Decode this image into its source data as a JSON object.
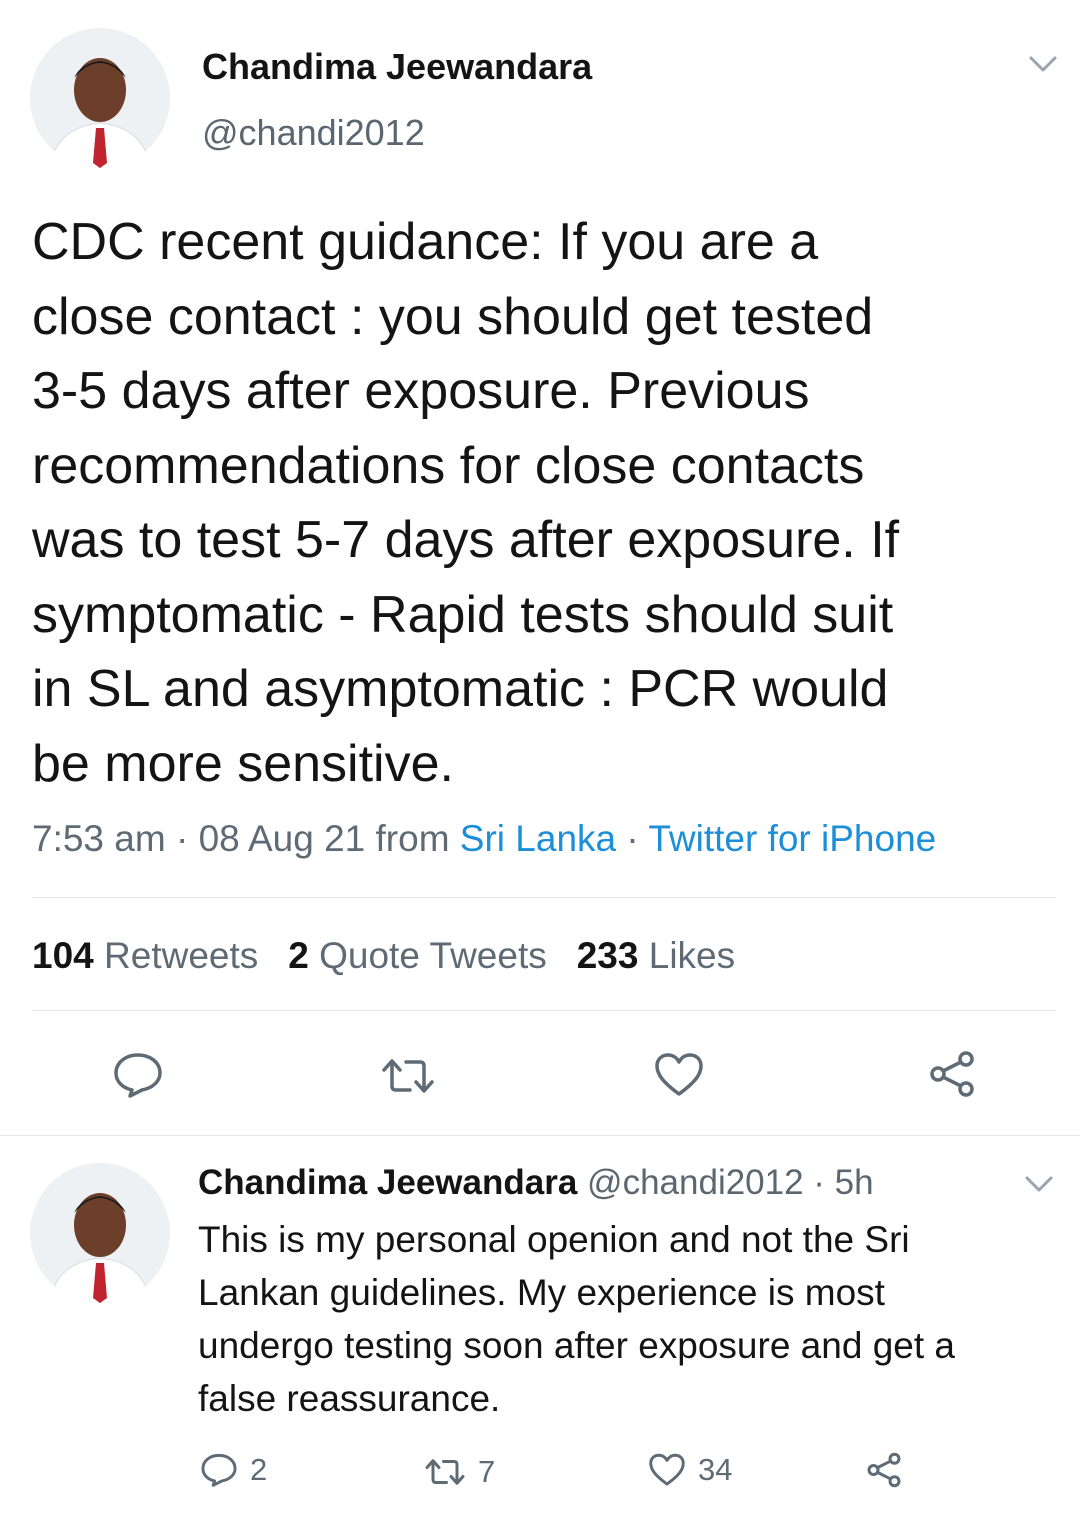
{
  "tweet": {
    "author_name": "Chandima Jeewandara",
    "author_handle": "@chandi2012",
    "text": "CDC recent guidance:  If you are a\nclose contact : you should get tested\n3-5 days after exposure. Previous\nrecommendations for close contacts\nwas to test 5-7 days after exposure. If\nsymptomatic - Rapid tests should suit\nin SL and asymptomatic : PCR would\nbe more sensitive.",
    "meta_prefix": "7:53 am · 08 Aug 21 from ",
    "location": "Sri Lanka",
    "meta_sep": " · ",
    "source": "Twitter for iPhone",
    "stats": {
      "retweets_count": "104",
      "retweets_label": "Retweets",
      "quotes_count": "2",
      "quotes_label": "Quote Tweets",
      "likes_count": "233",
      "likes_label": "Likes"
    }
  },
  "reply": {
    "author_name": "Chandima Jeewandara",
    "author_handle": "@chandi2012",
    "time": " · 5h",
    "text": "This is my personal openion and not the Sri\nLankan guidelines. My experience is most\nundergo testing soon after exposure and get a\nfalse reassurance.",
    "replies": "2",
    "retweets": "7",
    "likes": "34"
  },
  "icons": [
    "chevron-down-icon",
    "reply-icon",
    "retweet-icon",
    "like-icon",
    "share-icon"
  ],
  "colors": {
    "link": "#1d8fd8",
    "text": "#141414",
    "muted": "#5f6b74"
  }
}
